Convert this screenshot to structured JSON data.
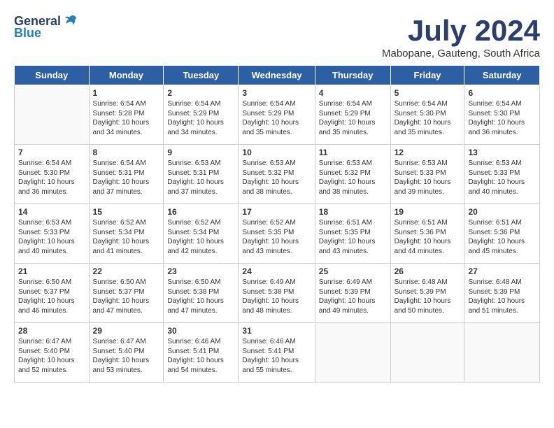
{
  "header": {
    "logo_general": "General",
    "logo_blue": "Blue",
    "title": "July 2024",
    "location": "Mabopane, Gauteng, South Africa"
  },
  "days_of_week": [
    "Sunday",
    "Monday",
    "Tuesday",
    "Wednesday",
    "Thursday",
    "Friday",
    "Saturday"
  ],
  "weeks": [
    [
      {
        "day": "",
        "info": ""
      },
      {
        "day": "1",
        "info": "Sunrise: 6:54 AM\nSunset: 5:28 PM\nDaylight: 10 hours\nand 34 minutes."
      },
      {
        "day": "2",
        "info": "Sunrise: 6:54 AM\nSunset: 5:29 PM\nDaylight: 10 hours\nand 34 minutes."
      },
      {
        "day": "3",
        "info": "Sunrise: 6:54 AM\nSunset: 5:29 PM\nDaylight: 10 hours\nand 35 minutes."
      },
      {
        "day": "4",
        "info": "Sunrise: 6:54 AM\nSunset: 5:29 PM\nDaylight: 10 hours\nand 35 minutes."
      },
      {
        "day": "5",
        "info": "Sunrise: 6:54 AM\nSunset: 5:30 PM\nDaylight: 10 hours\nand 35 minutes."
      },
      {
        "day": "6",
        "info": "Sunrise: 6:54 AM\nSunset: 5:30 PM\nDaylight: 10 hours\nand 36 minutes."
      }
    ],
    [
      {
        "day": "7",
        "info": "Sunrise: 6:54 AM\nSunset: 5:30 PM\nDaylight: 10 hours\nand 36 minutes."
      },
      {
        "day": "8",
        "info": "Sunrise: 6:54 AM\nSunset: 5:31 PM\nDaylight: 10 hours\nand 37 minutes."
      },
      {
        "day": "9",
        "info": "Sunrise: 6:53 AM\nSunset: 5:31 PM\nDaylight: 10 hours\nand 37 minutes."
      },
      {
        "day": "10",
        "info": "Sunrise: 6:53 AM\nSunset: 5:32 PM\nDaylight: 10 hours\nand 38 minutes."
      },
      {
        "day": "11",
        "info": "Sunrise: 6:53 AM\nSunset: 5:32 PM\nDaylight: 10 hours\nand 38 minutes."
      },
      {
        "day": "12",
        "info": "Sunrise: 6:53 AM\nSunset: 5:33 PM\nDaylight: 10 hours\nand 39 minutes."
      },
      {
        "day": "13",
        "info": "Sunrise: 6:53 AM\nSunset: 5:33 PM\nDaylight: 10 hours\nand 40 minutes."
      }
    ],
    [
      {
        "day": "14",
        "info": "Sunrise: 6:53 AM\nSunset: 5:33 PM\nDaylight: 10 hours\nand 40 minutes."
      },
      {
        "day": "15",
        "info": "Sunrise: 6:52 AM\nSunset: 5:34 PM\nDaylight: 10 hours\nand 41 minutes."
      },
      {
        "day": "16",
        "info": "Sunrise: 6:52 AM\nSunset: 5:34 PM\nDaylight: 10 hours\nand 42 minutes."
      },
      {
        "day": "17",
        "info": "Sunrise: 6:52 AM\nSunset: 5:35 PM\nDaylight: 10 hours\nand 43 minutes."
      },
      {
        "day": "18",
        "info": "Sunrise: 6:51 AM\nSunset: 5:35 PM\nDaylight: 10 hours\nand 43 minutes."
      },
      {
        "day": "19",
        "info": "Sunrise: 6:51 AM\nSunset: 5:36 PM\nDaylight: 10 hours\nand 44 minutes."
      },
      {
        "day": "20",
        "info": "Sunrise: 6:51 AM\nSunset: 5:36 PM\nDaylight: 10 hours\nand 45 minutes."
      }
    ],
    [
      {
        "day": "21",
        "info": "Sunrise: 6:50 AM\nSunset: 5:37 PM\nDaylight: 10 hours\nand 46 minutes."
      },
      {
        "day": "22",
        "info": "Sunrise: 6:50 AM\nSunset: 5:37 PM\nDaylight: 10 hours\nand 47 minutes."
      },
      {
        "day": "23",
        "info": "Sunrise: 6:50 AM\nSunset: 5:38 PM\nDaylight: 10 hours\nand 47 minutes."
      },
      {
        "day": "24",
        "info": "Sunrise: 6:49 AM\nSunset: 5:38 PM\nDaylight: 10 hours\nand 48 minutes."
      },
      {
        "day": "25",
        "info": "Sunrise: 6:49 AM\nSunset: 5:39 PM\nDaylight: 10 hours\nand 49 minutes."
      },
      {
        "day": "26",
        "info": "Sunrise: 6:48 AM\nSunset: 5:39 PM\nDaylight: 10 hours\nand 50 minutes."
      },
      {
        "day": "27",
        "info": "Sunrise: 6:48 AM\nSunset: 5:39 PM\nDaylight: 10 hours\nand 51 minutes."
      }
    ],
    [
      {
        "day": "28",
        "info": "Sunrise: 6:47 AM\nSunset: 5:40 PM\nDaylight: 10 hours\nand 52 minutes."
      },
      {
        "day": "29",
        "info": "Sunrise: 6:47 AM\nSunset: 5:40 PM\nDaylight: 10 hours\nand 53 minutes."
      },
      {
        "day": "30",
        "info": "Sunrise: 6:46 AM\nSunset: 5:41 PM\nDaylight: 10 hours\nand 54 minutes."
      },
      {
        "day": "31",
        "info": "Sunrise: 6:46 AM\nSunset: 5:41 PM\nDaylight: 10 hours\nand 55 minutes."
      },
      {
        "day": "",
        "info": ""
      },
      {
        "day": "",
        "info": ""
      },
      {
        "day": "",
        "info": ""
      }
    ]
  ]
}
